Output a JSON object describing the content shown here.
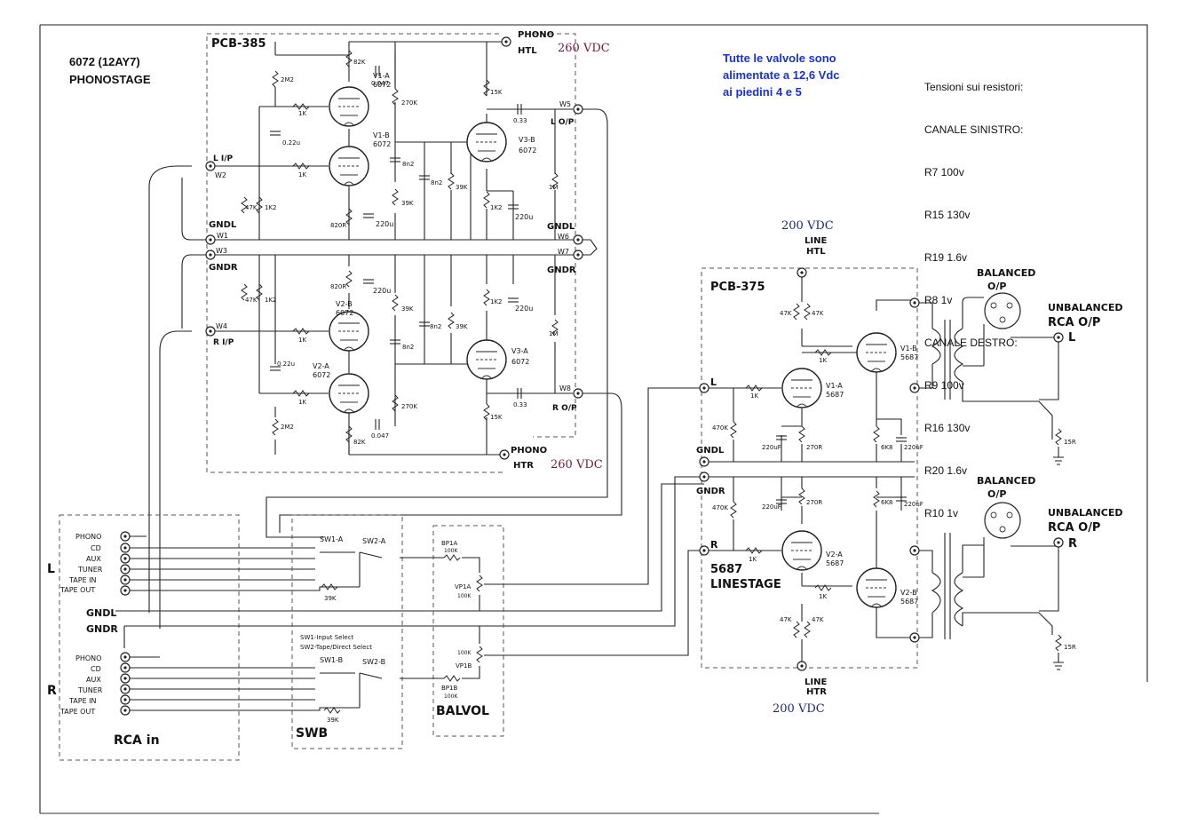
{
  "title": {
    "line1": "6072 (12AY7)",
    "line2": "PHONOSTAGE"
  },
  "note_blue": {
    "line1": "Tutte le valvole sono",
    "line2": "alimentate a 12,6 Vdc",
    "line3": "ai piedini 4 e 5"
  },
  "tensions": {
    "heading": "Tensioni sui resistori:",
    "left_heading": "CANALE SINISTRO:",
    "left": [
      "R7 100v",
      "R15 130v",
      "R19 1.6v",
      "R8 1v"
    ],
    "right_heading": "CANALE DESTRO:",
    "right": [
      "R9 100v",
      "R16 130v",
      "R20 1.6v",
      "R10 1v"
    ]
  },
  "boards": {
    "pcb385": "PCB-385",
    "pcb375": "PCB-375",
    "linestage": "5687",
    "linestage2": "LINESTAGE",
    "swb": "SWB",
    "balvol": "BALVOL",
    "rca_in": "RCA  in"
  },
  "voltages": {
    "phono_ht": "260 VDC",
    "line_ht": "200 VDC"
  },
  "connectors": {
    "phono": "PHONO",
    "htl": "HTL",
    "htr": "HTR",
    "line": "LINE",
    "w1": "W1",
    "w2": "W2",
    "w3": "W3",
    "w4": "W4",
    "w5": "W5",
    "w6": "W6",
    "w7": "W7",
    "w8": "W8",
    "l_ip": "L I/P",
    "r_ip": "R I/P",
    "l_op": "L O/P",
    "r_op": "R O/P",
    "gndl": "GNDL",
    "gndr": "GNDR",
    "l": "L",
    "r": "R"
  },
  "outputs": {
    "balanced": "BALANCED",
    "op": "O/P",
    "unbalanced": "UNBALANCED",
    "rca_op": "RCA O/P",
    "l": "L",
    "r": "R",
    "r15": "15R"
  },
  "inputs": {
    "labels": [
      "PHONO",
      "CD",
      "AUX",
      "TUNER",
      "TAPE IN",
      "TAPE OUT"
    ],
    "side_l": "L",
    "side_r": "R",
    "gndl": "GNDL",
    "gndr": "GNDR"
  },
  "switches": {
    "sw1a": "SW1-A",
    "sw2a": "SW2-A",
    "sw1b": "SW1-B",
    "sw2b": "SW2-B",
    "note1": "SW1-Input Select",
    "note2": "SW2-Tape/Direct Select",
    "r39k": "39K"
  },
  "pots": {
    "bp1a": "BP1A",
    "bp1b": "BP1B",
    "vp1a": "VP1A",
    "vp1b": "VP1B",
    "val": "100K"
  },
  "phono_tubes": {
    "v1a": [
      "V1-A",
      "6072"
    ],
    "v1b": [
      "V1-B",
      "6072"
    ],
    "v3b": [
      "V3-B",
      "6072"
    ],
    "v2b": [
      "V2-B",
      "6072"
    ],
    "v2a": [
      "V2-A",
      "6072"
    ],
    "v3a": [
      "V3-A",
      "6072"
    ]
  },
  "line_tubes": {
    "v1a": [
      "V1-A",
      "5687"
    ],
    "v1b": [
      "V1-B",
      "5687"
    ],
    "v2a": [
      "V2-A",
      "5687"
    ],
    "v2b": [
      "V2-B",
      "5687"
    ]
  },
  "phono_parts": {
    "R7": "82K",
    "C1": "0.047",
    "R3": "2M2",
    "R11": "1K",
    "R17": "270K",
    "R15": "15K",
    "C14": "0.33",
    "C12": "0.22u",
    "C7": "8n2",
    "C9": "8n2",
    "R25": "39K",
    "R12": "1K",
    "R4": "47K",
    "R1": "1K2",
    "R23": "39K",
    "R19": "1K2",
    "C5": "220u",
    "R21": "1M",
    "R8": "820R",
    "C3": "220u",
    "R10": "820R",
    "C4": "220u",
    "R6": "47K",
    "R2": "1K2",
    "R24": "39K",
    "R20": "1K2",
    "C6": "220u",
    "C10": "8n2",
    "R26": "39K",
    "R22": "1M",
    "R14": "1K",
    "C8": "8n2",
    "C11": "0.22u",
    "R13": "1K",
    "C13": "0.33",
    "R18": "270K",
    "R16": "15K",
    "R5": "2M2",
    "C2": "0.047",
    "R9": "82K"
  },
  "line_parts": {
    "R1": "47K",
    "R3": "47K",
    "R5": "1K",
    "R7": "1K",
    "R13": "470K",
    "C1": "220uF",
    "R11": "270R",
    "R9": "6K8",
    "C3": "220uF",
    "R14": "470K",
    "C2": "220uF",
    "R12": "270R",
    "R10": "6K8",
    "C4": "220uF",
    "R8": "1K",
    "R6": "1K",
    "R2": "47K",
    "R4": "47K"
  }
}
